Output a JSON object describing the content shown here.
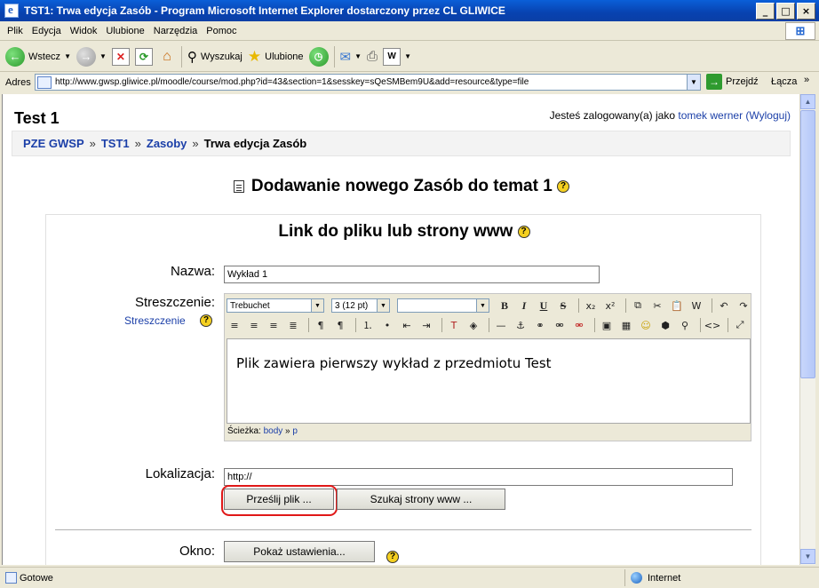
{
  "window": {
    "title": "TST1: Trwa edycja Zasób - Program Microsoft Internet Explorer dostarczony przez CL GLIWICE"
  },
  "menu": [
    "Plik",
    "Edycja",
    "Widok",
    "Ulubione",
    "Narzędzia",
    "Pomoc"
  ],
  "toolbar": {
    "back": "Wstecz",
    "search": "Wyszukaj",
    "favorites": "Ulubione"
  },
  "address": {
    "label": "Adres",
    "url": "http://www.gwsp.gliwice.pl/moodle/course/mod.php?id=43&section=1&sesskey=sQeSMBem9U&add=resource&type=file",
    "go": "Przejdź",
    "links": "Łącza"
  },
  "page": {
    "course_title": "Test 1",
    "login_prefix": "Jesteś zalogowany(a) jako",
    "login_user": "tomek werner",
    "logout": "(Wyloguj)",
    "breadcrumb": [
      "PZE GWSP",
      "TST1",
      "Zasoby",
      "Trwa edycja Zasób"
    ],
    "breadcrumb_sep": "»",
    "heading": "Dodawanie nowego Zasób do temat 1"
  },
  "form": {
    "legend": "Link do pliku lub strony www",
    "name_label": "Nazwa:",
    "name_value": "Wykład 1",
    "summary_label": "Streszczenie:",
    "summary_help_link": "Streszczenie",
    "editor": {
      "font": "Trebuchet",
      "size": "3 (12 pt)",
      "style": "",
      "content": "Plik zawiera pierwszy wykład z przedmiotu Test",
      "path_label": "Ścieżka:",
      "path_body": "body",
      "path_sep": "»",
      "path_p": "p"
    },
    "location_label": "Lokalizacja:",
    "location_value": "http://",
    "upload_button": "Prześlij plik ...",
    "search_button": "Szukaj strony www ...",
    "window_label": "Okno:",
    "window_button": "Pokaż ustawienia..."
  },
  "status": {
    "text": "Gotowe",
    "zone": "Internet"
  },
  "help_glyph": "?"
}
